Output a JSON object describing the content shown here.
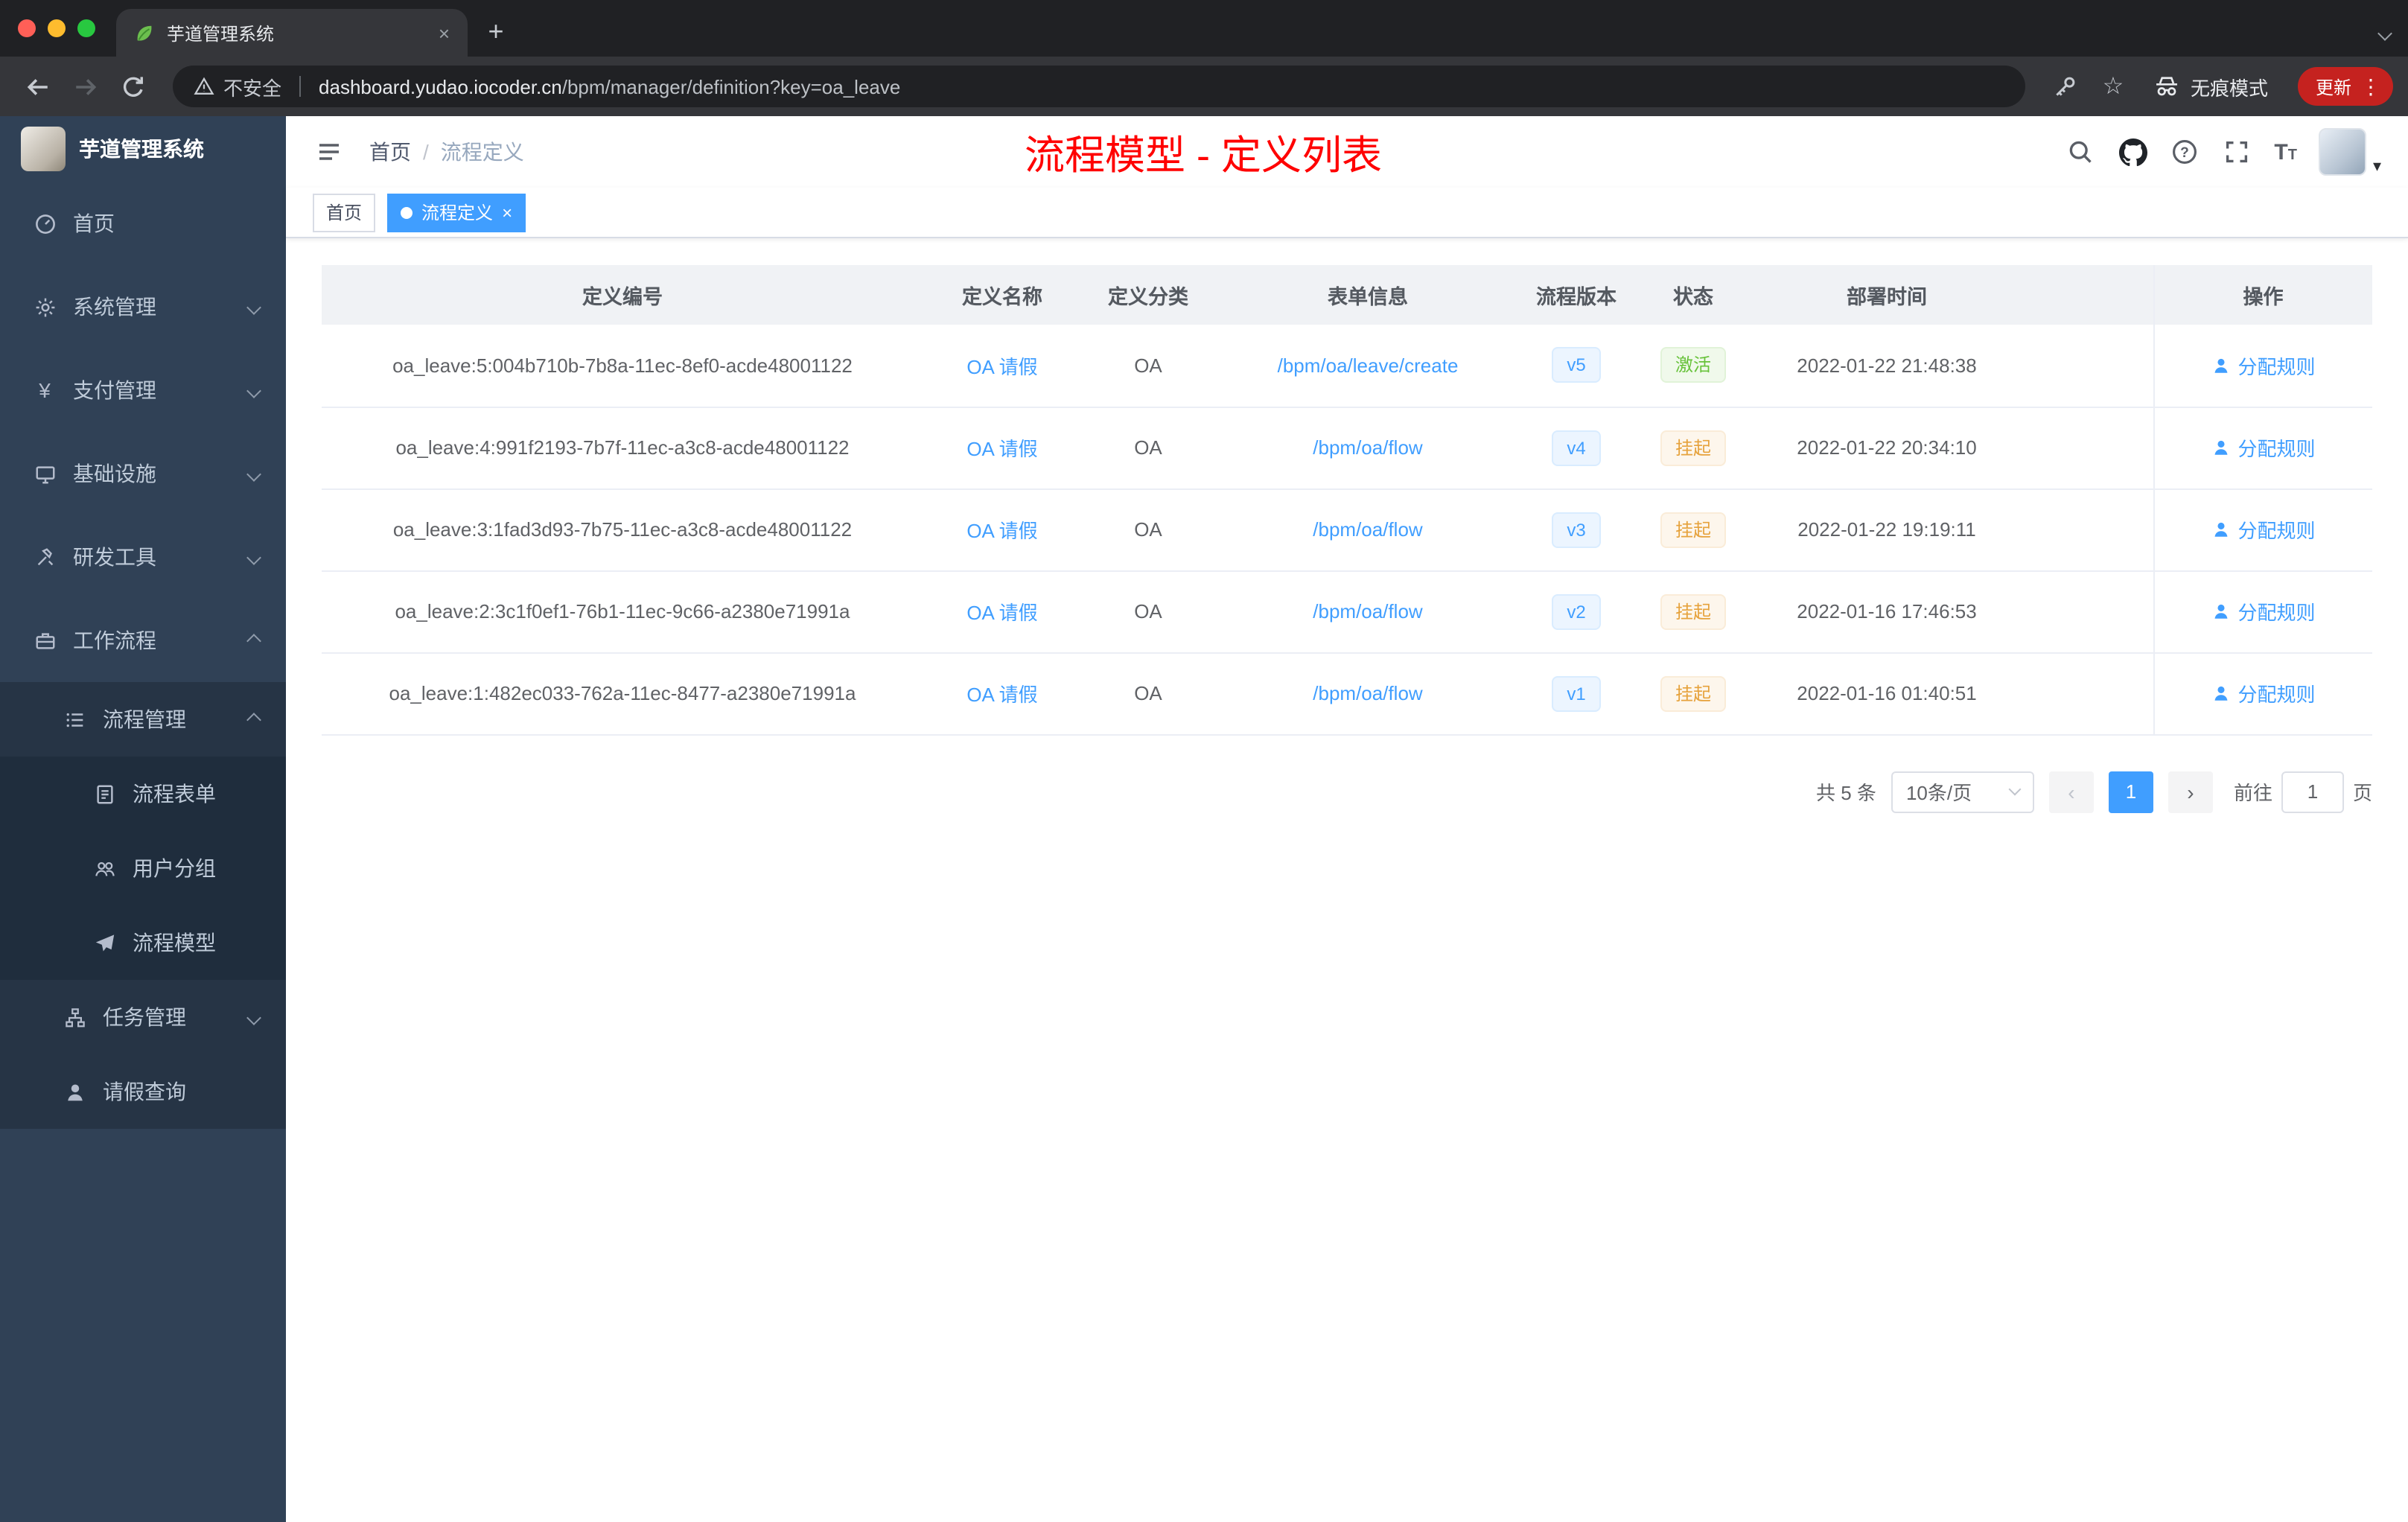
{
  "browser": {
    "tab_title": "芋道管理系统",
    "security_label": "不安全",
    "url_domain": "dashboard.yudao.iocoder.cn",
    "url_path": "/bpm/manager/definition?key=oa_leave",
    "incognito_label": "无痕模式",
    "update_label": "更新"
  },
  "icons": {
    "close": "×",
    "plus": "+",
    "star": "☆",
    "kebab": "⋮",
    "caret_down": "▾",
    "prev_arrow": "‹",
    "next_arrow": "›"
  },
  "sidebar": {
    "brand": "芋道管理系统",
    "items": [
      {
        "label": "首页"
      },
      {
        "label": "系统管理"
      },
      {
        "label": "支付管理"
      },
      {
        "label": "基础设施"
      },
      {
        "label": "研发工具"
      },
      {
        "label": "工作流程"
      },
      {
        "label": "流程管理"
      },
      {
        "label": "流程表单"
      },
      {
        "label": "用户分组"
      },
      {
        "label": "流程模型"
      },
      {
        "label": "任务管理"
      },
      {
        "label": "请假查询"
      }
    ]
  },
  "navbar": {
    "breadcrumb_home": "首页",
    "breadcrumb_current": "流程定义",
    "page_title": "流程模型 - 定义列表"
  },
  "tags": {
    "home": "首页",
    "active": "流程定义"
  },
  "table": {
    "headers": [
      "定义编号",
      "定义名称",
      "定义分类",
      "表单信息",
      "流程版本",
      "状态",
      "部署时间",
      "操作"
    ],
    "rows": [
      {
        "id": "oa_leave:5:004b710b-7b8a-11ec-8ef0-acde48001122",
        "name": "OA 请假",
        "category": "OA",
        "form": "/bpm/oa/leave/create",
        "version": "v5",
        "status": "激活",
        "time": "2022-01-22 21:48:38",
        "action": "分配规则"
      },
      {
        "id": "oa_leave:4:991f2193-7b7f-11ec-a3c8-acde48001122",
        "name": "OA 请假",
        "category": "OA",
        "form": "/bpm/oa/flow",
        "version": "v4",
        "status": "挂起",
        "time": "2022-01-22 20:34:10",
        "action": "分配规则"
      },
      {
        "id": "oa_leave:3:1fad3d93-7b75-11ec-a3c8-acde48001122",
        "name": "OA 请假",
        "category": "OA",
        "form": "/bpm/oa/flow",
        "version": "v3",
        "status": "挂起",
        "time": "2022-01-22 19:19:11",
        "action": "分配规则"
      },
      {
        "id": "oa_leave:2:3c1f0ef1-76b1-11ec-9c66-a2380e71991a",
        "name": "OA 请假",
        "category": "OA",
        "form": "/bpm/oa/flow",
        "version": "v2",
        "status": "挂起",
        "time": "2022-01-16 17:46:53",
        "action": "分配规则"
      },
      {
        "id": "oa_leave:1:482ec033-762a-11ec-8477-a2380e71991a",
        "name": "OA 请假",
        "category": "OA",
        "form": "/bpm/oa/flow",
        "version": "v1",
        "status": "挂起",
        "time": "2022-01-16 01:40:51",
        "action": "分配规则"
      }
    ]
  },
  "pagination": {
    "total": "共 5 条",
    "page_size": "10条/页",
    "page": "1",
    "goto_label": "前往",
    "goto_value": "1",
    "unit_label": "页"
  }
}
